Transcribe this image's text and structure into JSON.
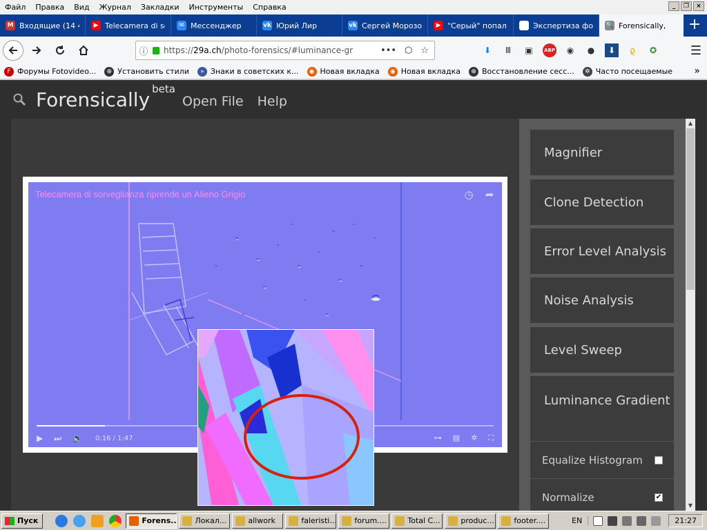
{
  "menubar": {
    "items": [
      "Файл",
      "Правка",
      "Вид",
      "Журнал",
      "Закладки",
      "Инструменты",
      "Справка"
    ],
    "controls": [
      "_",
      "❐",
      "×"
    ]
  },
  "tabs": [
    {
      "label": "Входящие (14 4",
      "icon": "gmail-icon",
      "color": "#d93025",
      "glyph": "M"
    },
    {
      "label": "Telecamera di so",
      "icon": "youtube-icon",
      "color": "#ff0000",
      "glyph": "▶"
    },
    {
      "label": "Мессенджер",
      "icon": "messenger-icon",
      "color": "#2d88ff",
      "glyph": "✉"
    },
    {
      "label": "Юрий Лир",
      "icon": "vk-icon",
      "color": "#2787f5",
      "glyph": "vk"
    },
    {
      "label": "Сергей Морозов",
      "icon": "vk-icon",
      "color": "#2787f5",
      "glyph": "vk"
    },
    {
      "label": "\"Серый\" попал н",
      "icon": "youtube-icon",
      "color": "#ff0000",
      "glyph": "▶"
    },
    {
      "label": "Экспертиза фото- и",
      "icon": "page-icon",
      "color": "#ffffff",
      "glyph": ""
    },
    {
      "label": "Forensically, ",
      "icon": "search-icon",
      "color": "#888888",
      "glyph": "🔍"
    }
  ],
  "new_tab": "+",
  "url": {
    "prefix": "https://",
    "host": "29a.ch",
    "path": "/photo-forensics/#luminance-gr"
  },
  "bookmarks": [
    {
      "label": "Форумы Fotovideo...",
      "icon": "fotovideo-icon",
      "color": "#cc0000",
      "glyph": "F"
    },
    {
      "label": "Установить стили",
      "icon": "globe-icon",
      "color": "#333333",
      "glyph": "⊕"
    },
    {
      "label": "Знаки в советских к...",
      "icon": "bookmark-icon",
      "color": "#3a5ba0",
      "glyph": "»"
    },
    {
      "label": "Новая вкладка",
      "icon": "firefox-icon",
      "color": "#e66000",
      "glyph": "◉"
    },
    {
      "label": "Новая вкладка",
      "icon": "firefox-icon",
      "color": "#e66000",
      "glyph": "◉"
    },
    {
      "label": "Восстановление сесс...",
      "icon": "globe-icon",
      "color": "#333333",
      "glyph": "⊕"
    },
    {
      "label": "Часто посещаемые",
      "icon": "gear-icon",
      "color": "#444444",
      "glyph": "✲"
    }
  ],
  "app": {
    "brand": "Forensically",
    "beta": "beta",
    "nav": [
      "Open File",
      "Help"
    ]
  },
  "viewer": {
    "title": "Telecamera di sorveglianza riprende un Alieno Grigio",
    "time": "0:16 / 1:47",
    "progress_fraction": 0.15
  },
  "tools": [
    "Magnifier",
    "Clone Detection",
    "Error Level Analysis",
    "Noise Analysis",
    "Level Sweep",
    "Luminance Gradient"
  ],
  "options": [
    {
      "label": "Equalize Histogram",
      "checked": false
    },
    {
      "label": "Normalize",
      "checked": true
    }
  ],
  "taskbar": {
    "start": "Пуск",
    "tasks": [
      "Forens...",
      "Локал...",
      "allwork",
      "faleristi...",
      "forum....",
      "Total C...",
      "produc...",
      "footer...."
    ],
    "lang": "EN",
    "clock": "21:27"
  }
}
